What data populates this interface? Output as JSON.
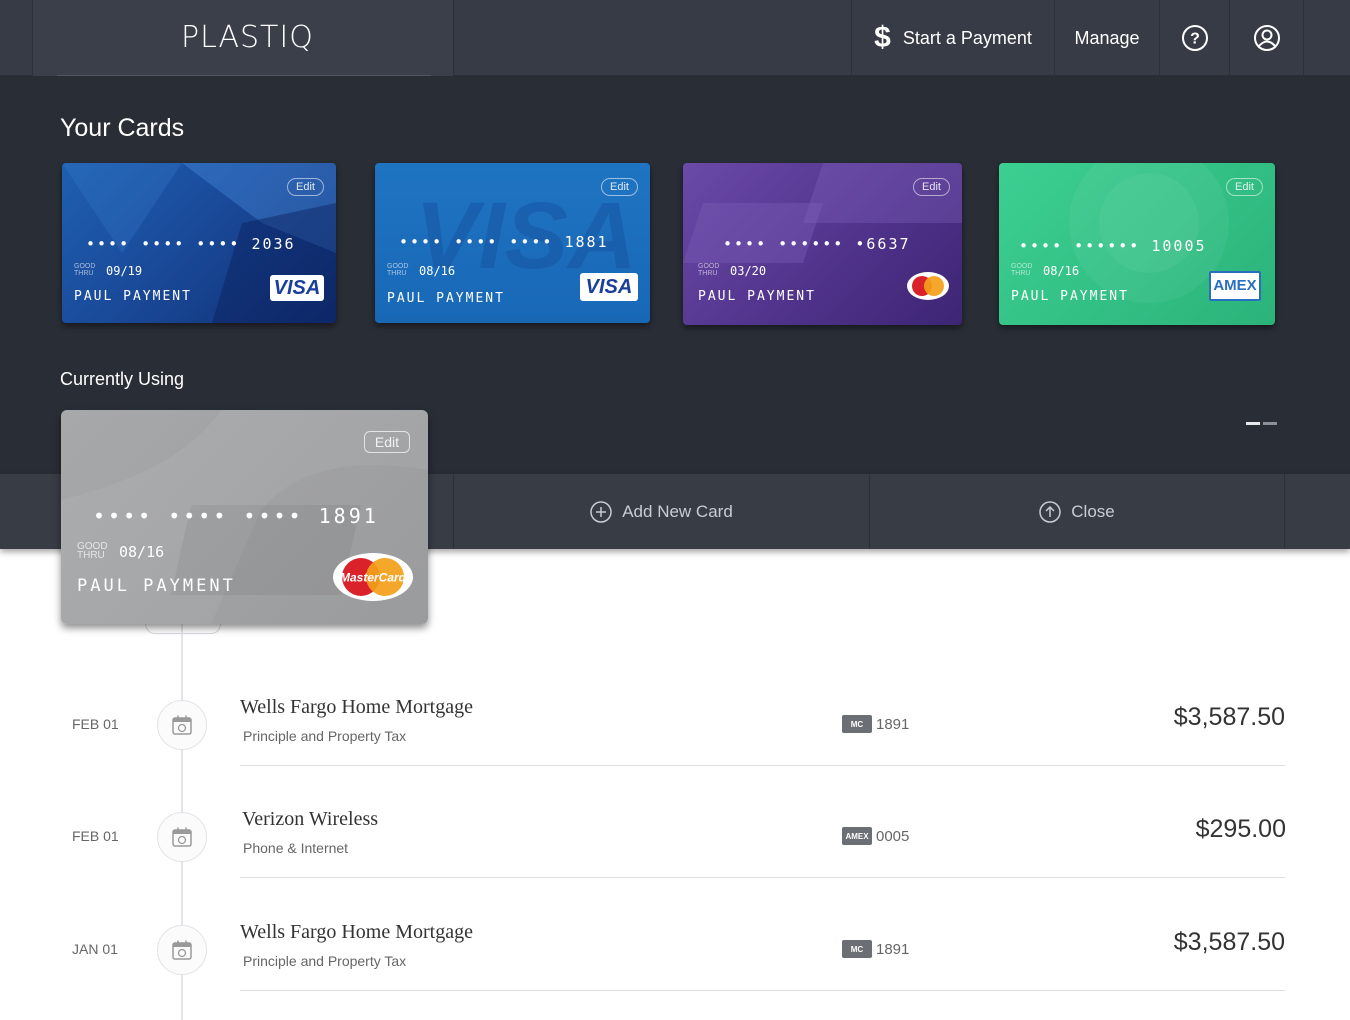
{
  "nav": {
    "logo": "PLASTIQ",
    "start_payment": "Start a Payment",
    "manage": "Manage"
  },
  "your_cards": {
    "title": "Your Cards",
    "cards": [
      {
        "number": "•••• •••• •••• 2036",
        "good_thru_label": "GOOD THRU",
        "expiry": "09/19",
        "holder": "PAUL PAYMENT",
        "brand": "VISA",
        "edit": "Edit",
        "color": "#1a4a9a"
      },
      {
        "number": "•••• •••• •••• 1881",
        "good_thru_label": "GOOD THRU",
        "expiry": "08/16",
        "holder": "PAUL PAYMENT",
        "brand": "VISA",
        "edit": "Edit",
        "color": "#1868b6"
      },
      {
        "number": "•••• •••••• •6637",
        "good_thru_label": "GOOD THRU",
        "expiry": "03/20",
        "holder": "PAUL PAYMENT",
        "brand": "MasterCard",
        "edit": "Edit",
        "color": "#4e3189"
      },
      {
        "number": "•••• •••••• 10005",
        "good_thru_label": "GOOD THRU",
        "expiry": "08/16",
        "holder": "PAUL PAYMENT",
        "brand": "AMEX",
        "edit": "Edit",
        "color": "#2bb37a"
      }
    ]
  },
  "currently_using": {
    "title": "Currently Using",
    "card": {
      "number": "•••• •••• •••• 1891",
      "good_thru_label": "GOOD THRU",
      "expiry": "08/16",
      "holder": "PAUL PAYMENT",
      "brand": "MasterCard",
      "edit": "Edit"
    }
  },
  "actions": {
    "add_new_card": "Add New Card",
    "close": "Close"
  },
  "payments": [
    {
      "date": "FEB 01",
      "payee": "Wells Fargo Home Mortgage",
      "description": "Principle and Property Tax",
      "card_brand": "MC",
      "card_last4": "1891",
      "amount": "$3,587.50"
    },
    {
      "date": "FEB 01",
      "payee": "Verizon Wireless",
      "description": "Phone & Internet",
      "card_brand": "AMEX",
      "card_last4": "0005",
      "amount": "$295.00"
    },
    {
      "date": "JAN 01",
      "payee": "Wells Fargo Home Mortgage",
      "description": "Principle and Property Tax",
      "card_brand": "MC",
      "card_last4": "1891",
      "amount": "$3,587.50"
    }
  ],
  "colors": {
    "nav_bg": "#363b45",
    "cards_bg": "#292d35",
    "action_bg": "#383c45"
  }
}
